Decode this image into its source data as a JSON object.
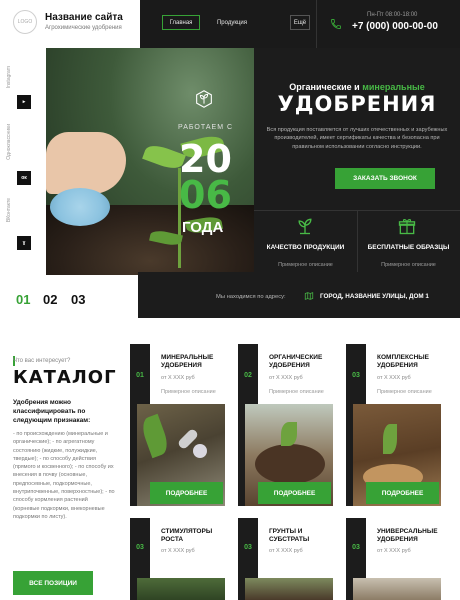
{
  "header": {
    "logo_text": "LOGO",
    "site_name": "Название сайта",
    "tagline": "Агрохимические удобрения",
    "nav": [
      {
        "label": "Главная",
        "active": true
      },
      {
        "label": "Продукция",
        "active": false
      }
    ],
    "more_label": "Ещё",
    "hours": "Пн-Пт 08:00-18:00",
    "phone": "+7 (000) 000-00-00"
  },
  "rail": {
    "items": [
      {
        "label": "Instagram",
        "icon": "instagram-icon",
        "box": "▸"
      },
      {
        "label": "Одноклассники",
        "icon": "ok-icon",
        "box": "ок"
      },
      {
        "label": "ВКонтакте",
        "icon": "vk-icon",
        "box": "ɣ"
      }
    ]
  },
  "hero": {
    "since_label": "РАБОТАЕМ С",
    "year_top": "20",
    "year_bottom": "06",
    "years_word": "ГОДА",
    "subtitle_a": "Органические и ",
    "subtitle_b": "минеральные",
    "title": "УДОБРЕНИЯ",
    "description": "Вся продукция поставляется от лучших отечественных и зарубежных производителей, имеет сертификаты качества и безопасна при правильном использовании согласно инструкции.",
    "cta_label": "ЗАКАЗАТЬ ЗВОНОК",
    "features": [
      {
        "title": "КАЧЕСТВО ПРОДУКЦИИ",
        "desc": "Примерное описание",
        "icon": "sprout-icon"
      },
      {
        "title": "БЕСПЛАТНЫЕ ОБРАЗЦЫ",
        "desc": "Примерное описание",
        "icon": "gift-icon"
      }
    ],
    "slides": [
      "01",
      "02",
      "03"
    ],
    "active_slide": 0,
    "address_label": "Мы находимся по адресу:",
    "address_value": "ГОРОД, НАЗВАНИЕ УЛИЦЫ, ДОМ 1"
  },
  "catalog": {
    "question": "Что вас интересует?",
    "title": "КАТАЛОГ",
    "classify": "Удобрения можно классифицировать по следующим признакам:",
    "criteria": "- по происхождению (минеральные и органические); - по агрегатному состоянию (жидкие, полужидкие, твердые); - по способу действия (прямого и косвенного); - по способу их внесения в почву (основные, предпосевные, подкормочные, внутрипочвенные, поверхностные); - по способу кормления растений (корневые подкормки, внекорневые подкормки по листу).",
    "all_label": "ВСЕ ПОЗИЦИИ",
    "cards": [
      {
        "num": "01",
        "title": "МИНЕРАЛЬНЫЕ УДОБРЕНИЯ",
        "price": "от Х ХХХ руб",
        "desc": "Примерное описание",
        "more": "ПОДРОБНЕЕ"
      },
      {
        "num": "02",
        "title": "ОРГАНИЧЕСКИЕ УДОБРЕНИЯ",
        "price": "от Х ХХХ руб",
        "desc": "Примерное описание",
        "more": "ПОДРОБНЕЕ"
      },
      {
        "num": "03",
        "title": "КОМПЛЕКСНЫЕ УДОБРЕНИЯ",
        "price": "от Х ХХХ руб",
        "desc": "Примерное описание",
        "more": "ПОДРОБНЕЕ"
      },
      {
        "num": "03",
        "title": "СТИМУЛЯТОРЫ РОСТА",
        "price": "от Х ХХХ руб",
        "desc": "",
        "more": ""
      },
      {
        "num": "03",
        "title": "ГРУНТЫ И СУБСТРАТЫ",
        "price": "от Х ХХХ руб",
        "desc": "",
        "more": ""
      },
      {
        "num": "03",
        "title": "УНИВЕРСАЛЬНЫЕ УДОБРЕНИЯ",
        "price": "от Х ХХХ руб",
        "desc": "",
        "more": ""
      }
    ]
  },
  "colors": {
    "accent": "#37a236",
    "dark": "#1c1c1c",
    "accent_light": "#48b946"
  }
}
